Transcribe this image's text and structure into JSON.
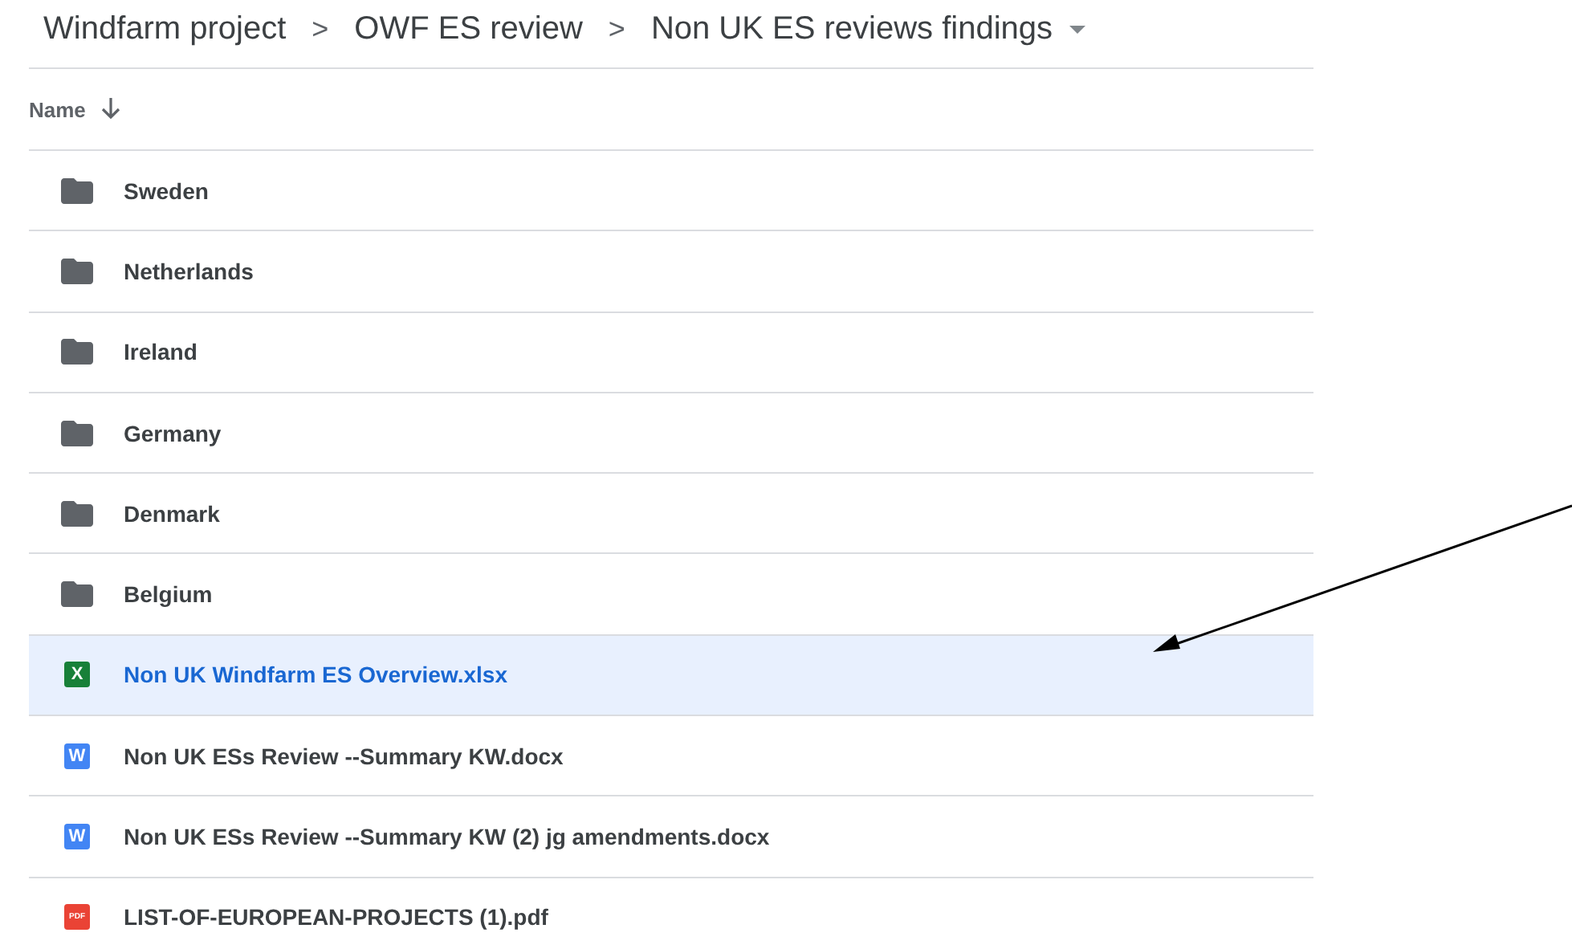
{
  "breadcrumb": [
    {
      "label": "Windfarm project"
    },
    {
      "label": "OWF ES review"
    },
    {
      "label": "Non UK ES reviews findings"
    }
  ],
  "breadcrumb_dropdown": true,
  "breadcrumb_separator": ">",
  "table": {
    "columns": [
      {
        "label": "Name",
        "sorted_descending": true
      }
    ],
    "rows": [
      {
        "name": "Sweden",
        "kind": "folder",
        "selected": false
      },
      {
        "name": "Netherlands",
        "kind": "folder",
        "selected": false
      },
      {
        "name": "Ireland",
        "kind": "folder",
        "selected": false
      },
      {
        "name": "Germany",
        "kind": "folder",
        "selected": false
      },
      {
        "name": "Denmark",
        "kind": "folder",
        "selected": false
      },
      {
        "name": "Belgium",
        "kind": "folder",
        "selected": false
      },
      {
        "name": "Non UK Windfarm ES Overview.xlsx",
        "kind": "sheet",
        "icon_label": "X",
        "selected": true
      },
      {
        "name": "Non UK ESs Review --Summary KW.docx",
        "kind": "doc",
        "icon_label": "W",
        "selected": false
      },
      {
        "name": "Non UK ESs Review --Summary KW (2) jg amendments.docx",
        "kind": "doc",
        "icon_label": "W",
        "selected": false
      },
      {
        "name": "LIST-OF-EUROPEAN-PROJECTS (1).pdf",
        "kind": "pdf",
        "icon_label": "PDF",
        "selected": false
      }
    ]
  }
}
